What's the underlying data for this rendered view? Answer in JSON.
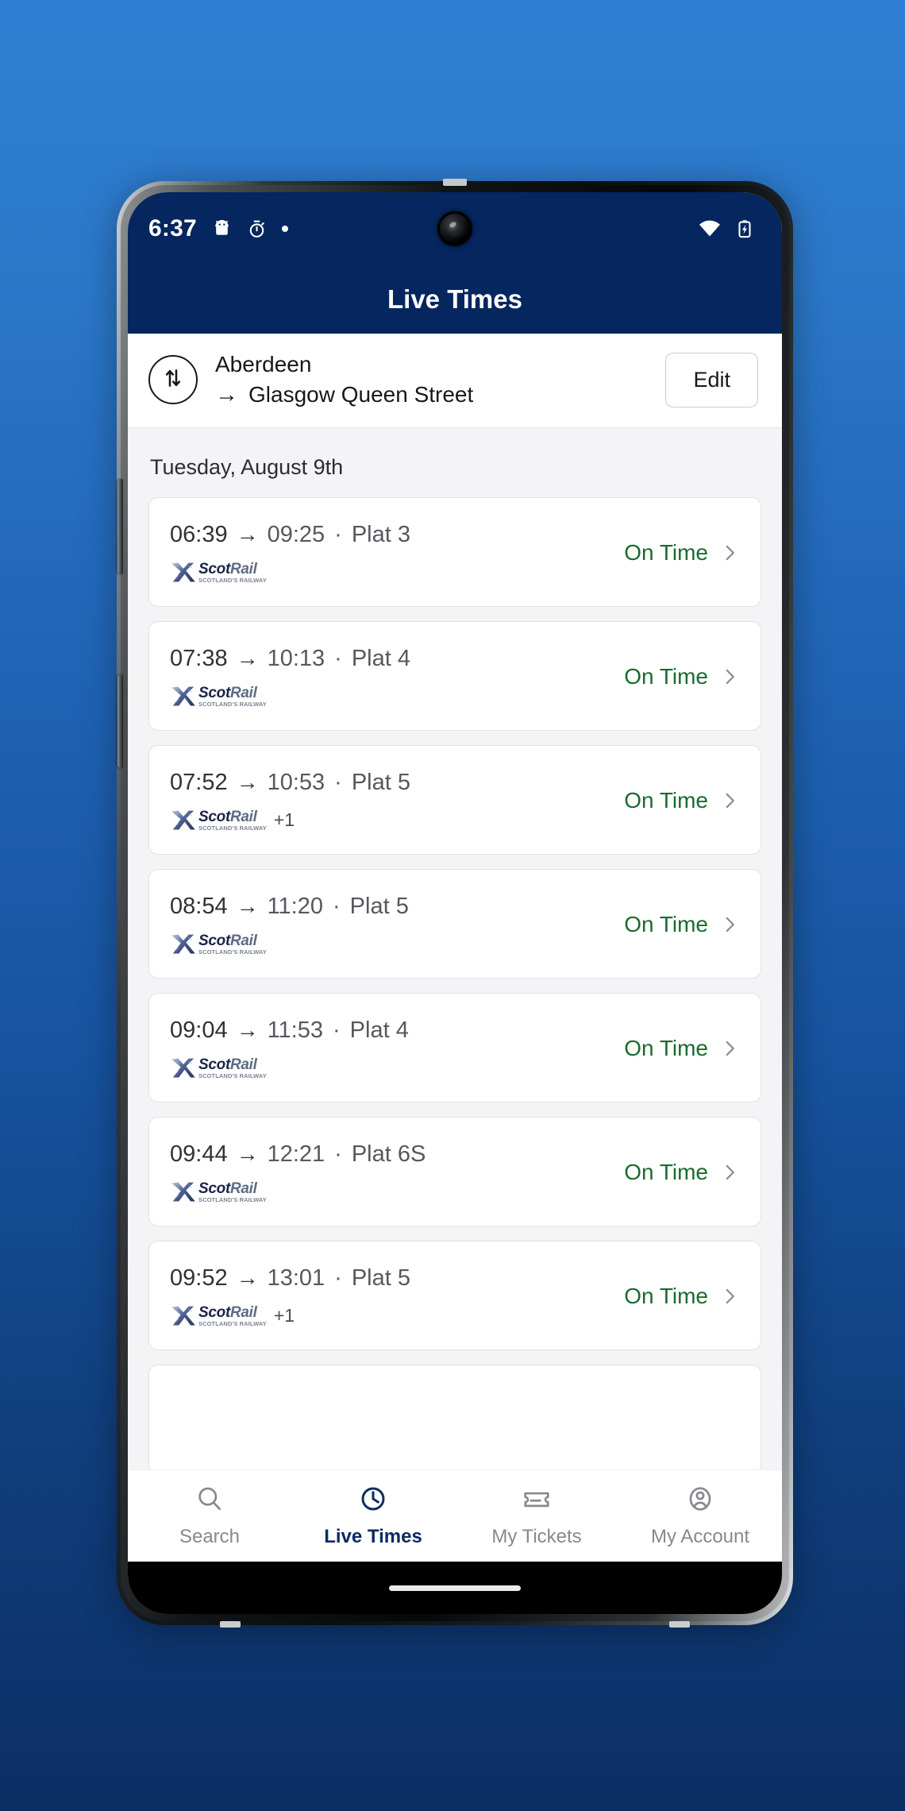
{
  "statusbar": {
    "time": "6:37",
    "icons_left": [
      "android-debug-icon",
      "timer-icon",
      "dot-indicator-icon"
    ],
    "icons_right": [
      "wifi-icon",
      "battery-charging-icon"
    ]
  },
  "appbar": {
    "title": "Live Times"
  },
  "route": {
    "swap_icon": "swap-vertical-icon",
    "from": "Aberdeen",
    "arrow": "→",
    "to": "Glasgow Queen Street",
    "edit_label": "Edit"
  },
  "list": {
    "date_header": "Tuesday, August 9th",
    "operator_name_a": "Scot",
    "operator_name_b": "Rail",
    "operator_tagline": "SCOTLAND'S RAILWAY",
    "arrow": "→",
    "separator": "·",
    "journeys": [
      {
        "departure": "06:39",
        "arrival": "09:25",
        "platform": "Plat 3",
        "operator": "ScotRail",
        "extra_operators": "",
        "status": "On Time"
      },
      {
        "departure": "07:38",
        "arrival": "10:13",
        "platform": "Plat 4",
        "operator": "ScotRail",
        "extra_operators": "",
        "status": "On Time"
      },
      {
        "departure": "07:52",
        "arrival": "10:53",
        "platform": "Plat 5",
        "operator": "ScotRail",
        "extra_operators": "+1",
        "status": "On Time"
      },
      {
        "departure": "08:54",
        "arrival": "11:20",
        "platform": "Plat 5",
        "operator": "ScotRail",
        "extra_operators": "",
        "status": "On Time"
      },
      {
        "departure": "09:04",
        "arrival": "11:53",
        "platform": "Plat 4",
        "operator": "ScotRail",
        "extra_operators": "",
        "status": "On Time"
      },
      {
        "departure": "09:44",
        "arrival": "12:21",
        "platform": "Plat 6S",
        "operator": "ScotRail",
        "extra_operators": "",
        "status": "On Time"
      },
      {
        "departure": "09:52",
        "arrival": "13:01",
        "platform": "Plat 5",
        "operator": "ScotRail",
        "extra_operators": "+1",
        "status": "On Time"
      }
    ]
  },
  "bottomnav": {
    "items": [
      {
        "label": "Search",
        "icon": "search-icon",
        "active": false
      },
      {
        "label": "Live Times",
        "icon": "clock-icon",
        "active": true
      },
      {
        "label": "My Tickets",
        "icon": "ticket-icon",
        "active": false
      },
      {
        "label": "My Account",
        "icon": "person-icon",
        "active": false
      }
    ]
  },
  "colors": {
    "brand_navy": "#05265e",
    "status_green": "#1a6b2e",
    "accent_active": "#0d2b62",
    "page_background": "#1f63b4"
  }
}
